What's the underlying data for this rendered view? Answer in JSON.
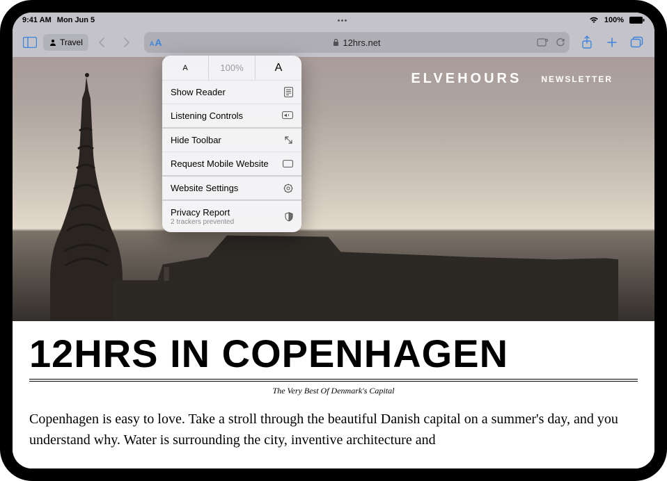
{
  "status": {
    "time": "9:41 AM",
    "date": "Mon Jun 5",
    "battery_pct": "100%"
  },
  "toolbar": {
    "profile_label": "Travel",
    "url_display": "12hrs.net"
  },
  "popover": {
    "zoom_pct": "100%",
    "show_reader": "Show Reader",
    "listening_controls": "Listening Controls",
    "hide_toolbar": "Hide Toolbar",
    "request_mobile": "Request Mobile Website",
    "website_settings": "Website Settings",
    "privacy_report": "Privacy Report",
    "privacy_sub": "2 trackers prevented"
  },
  "site": {
    "brand": "ELVEHOURS",
    "newsletter": "NEWSLETTER"
  },
  "article": {
    "headline": "12HRS IN COPENHAGEN",
    "subtitle": "The Very Best Of Denmark's Capital",
    "body": "Copenhagen is easy to love. Take a stroll through the beautiful Danish capital on a summer's day, and you understand why. Water is surrounding the city, inventive architecture and"
  }
}
